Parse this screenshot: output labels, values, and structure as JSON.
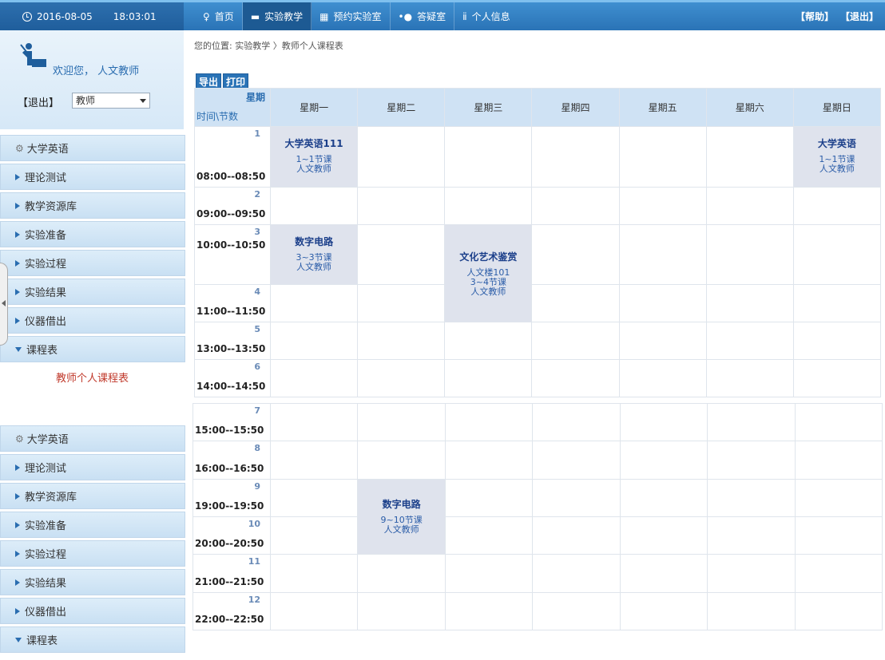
{
  "header": {
    "date": "2016-08-05",
    "time": "18:03:01",
    "nav": [
      {
        "label": "首页",
        "icon": "bulb-icon"
      },
      {
        "label": "实验教学",
        "icon": "teacher-icon"
      },
      {
        "label": "预约实验室",
        "icon": "calendar-icon"
      },
      {
        "label": "答疑室",
        "icon": "chat-icon"
      },
      {
        "label": "个人信息",
        "icon": "person-icon"
      }
    ],
    "help": "【帮助】",
    "exit": "【退出】"
  },
  "user": {
    "welcome": "欢迎您，  人文教师",
    "logout": "【退出】",
    "role": "教师"
  },
  "sidebar": {
    "course": "大学英语",
    "items": [
      "理论测试",
      "教学资源库",
      "实验准备",
      "实验过程",
      "实验结果",
      "仪器借出"
    ],
    "schedule": "课程表",
    "sub": "教师个人课程表"
  },
  "breadcrumb": "您的位置: 实验教学 〉教师个人课程表",
  "tools": {
    "export": "导出",
    "print": "打印"
  },
  "table": {
    "corner_week": "星期",
    "corner_time": "时间\\节数",
    "days": [
      "星期一",
      "星期二",
      "星期三",
      "星期四",
      "星期五",
      "星期六",
      "星期日"
    ],
    "slots": [
      {
        "num": "1",
        "time": "08:00--08:50"
      },
      {
        "num": "2",
        "time": "09:00--09:50"
      },
      {
        "num": "3",
        "time": "10:00--10:50"
      },
      {
        "num": "4",
        "time": "11:00--11:50"
      },
      {
        "num": "5",
        "time": "13:00--13:50"
      },
      {
        "num": "6",
        "time": "14:00--14:50"
      },
      {
        "num": "7",
        "time": "15:00--15:50"
      },
      {
        "num": "8",
        "time": "16:00--16:50"
      },
      {
        "num": "9",
        "time": "19:00--19:50"
      },
      {
        "num": "10",
        "time": "20:00--20:50"
      },
      {
        "num": "11",
        "time": "21:00--21:50"
      },
      {
        "num": "12",
        "time": "22:00--22:50"
      }
    ],
    "courses": {
      "mon1": {
        "name": "大学英语111",
        "l1": "1~1节课",
        "l2": "人文教师"
      },
      "sun1": {
        "name": "大学英语",
        "l1": "1~1节课",
        "l2": "人文教师"
      },
      "mon3": {
        "name": "数字电路",
        "l1": "3~3节课",
        "l2": "人文教师"
      },
      "wed3": {
        "name": "文化艺术鉴赏",
        "l1": "人文楼101",
        "l2": "3~4节课",
        "l3": "人文教师"
      },
      "tue9": {
        "name": "数字电路",
        "l1": "9~10节课",
        "l2": "人文教师"
      }
    }
  }
}
